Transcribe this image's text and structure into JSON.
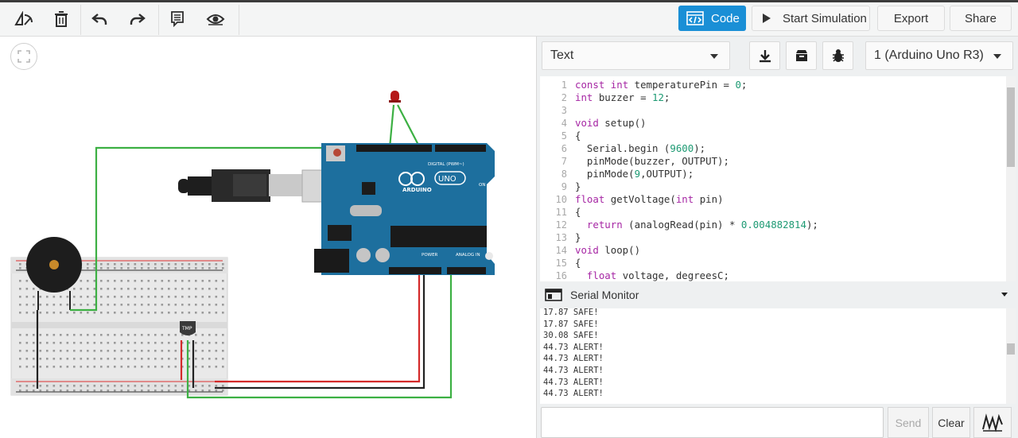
{
  "toolbar": {
    "code_label": "Code",
    "start_simulation_label": "Start Simulation",
    "export_label": "Export",
    "share_label": "Share",
    "icons": [
      "rotate-icon",
      "delete-icon",
      "undo-icon",
      "redo-icon",
      "notes-icon",
      "visibility-icon"
    ]
  },
  "code_panel": {
    "mode_select": "Text",
    "device_select": "1 (Arduino Uno R3)",
    "icons": [
      "download-icon",
      "library-icon",
      "debug-icon"
    ],
    "lines": [
      {
        "n": "1",
        "text": "const int temperaturePin = 0;"
      },
      {
        "n": "2",
        "text": "int buzzer = 12;"
      },
      {
        "n": "3",
        "text": ""
      },
      {
        "n": "4",
        "text": "void setup()"
      },
      {
        "n": "5",
        "text": "{"
      },
      {
        "n": "6",
        "text": "  Serial.begin (9600);"
      },
      {
        "n": "7",
        "text": "  pinMode(buzzer, OUTPUT);"
      },
      {
        "n": "8",
        "text": "  pinMode(9,OUTPUT);"
      },
      {
        "n": "9",
        "text": "}"
      },
      {
        "n": "10",
        "text": "float getVoltage(int pin)"
      },
      {
        "n": "11",
        "text": "{"
      },
      {
        "n": "12",
        "text": "  return (analogRead(pin) * 0.004882814);"
      },
      {
        "n": "13",
        "text": "}"
      },
      {
        "n": "14",
        "text": "void loop()"
      },
      {
        "n": "15",
        "text": "{"
      },
      {
        "n": "16",
        "text": "  float voltage, degreesC;"
      }
    ]
  },
  "serial_monitor": {
    "title": "Serial Monitor",
    "output": [
      "17.87 SAFE!",
      "17.87 SAFE!",
      "30.08 SAFE!",
      "44.73 ALERT!",
      "44.73 ALERT!",
      "44.73 ALERT!",
      "44.73 ALERT!",
      "44.73 ALERT!"
    ],
    "send_label": "Send",
    "clear_label": "Clear"
  },
  "canvas": {
    "board_labels": {
      "brand": "ARDUINO",
      "model": "UNO",
      "digital": "DIGITAL (PWM~)",
      "analog": "ANALOG IN",
      "power": "POWER",
      "on": "ON",
      "tmp": "TMP"
    }
  },
  "colors": {
    "accent": "#1a8fd6",
    "wire_green": "#3cb043",
    "wire_red": "#d42a2a",
    "board_blue": "#1d6f9e"
  }
}
